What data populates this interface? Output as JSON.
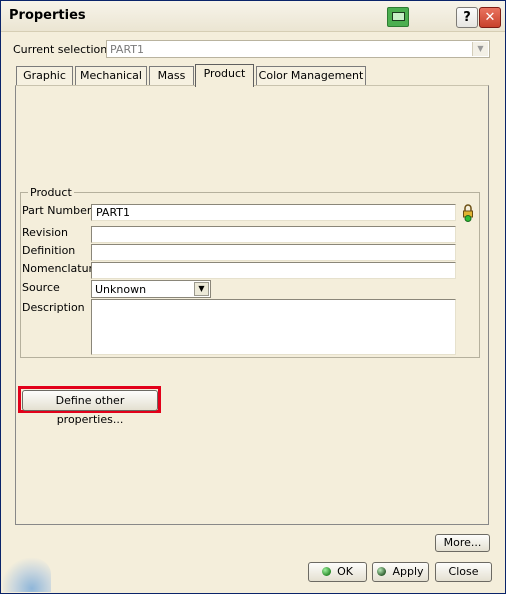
{
  "window": {
    "title": "Properties"
  },
  "titlebar": {
    "help_label": "?",
    "close_label": "✕",
    "catia_icon": "catia-icon"
  },
  "selection": {
    "label": "Current selection :",
    "value": "PART1"
  },
  "tabs": [
    {
      "label": "Graphic"
    },
    {
      "label": "Mechanical"
    },
    {
      "label": "Mass"
    },
    {
      "label": "Product",
      "active": true
    },
    {
      "label": "Color Management"
    }
  ],
  "product": {
    "group_title": "Product",
    "part_number": {
      "label": "Part Number",
      "value": "PART1"
    },
    "revision": {
      "label": "Revision",
      "value": ""
    },
    "definition": {
      "label": "Definition",
      "value": ""
    },
    "nomenclature": {
      "label": "Nomenclature",
      "value": ""
    },
    "source": {
      "label": "Source",
      "value": "Unknown"
    },
    "description": {
      "label": "Description",
      "value": ""
    }
  },
  "buttons": {
    "define_other": "Define other properties...",
    "more": "More...",
    "ok": "OK",
    "apply": "Apply",
    "close": "Close"
  },
  "colors": {
    "highlight": "#e2001a",
    "background": "#f4eedb"
  }
}
